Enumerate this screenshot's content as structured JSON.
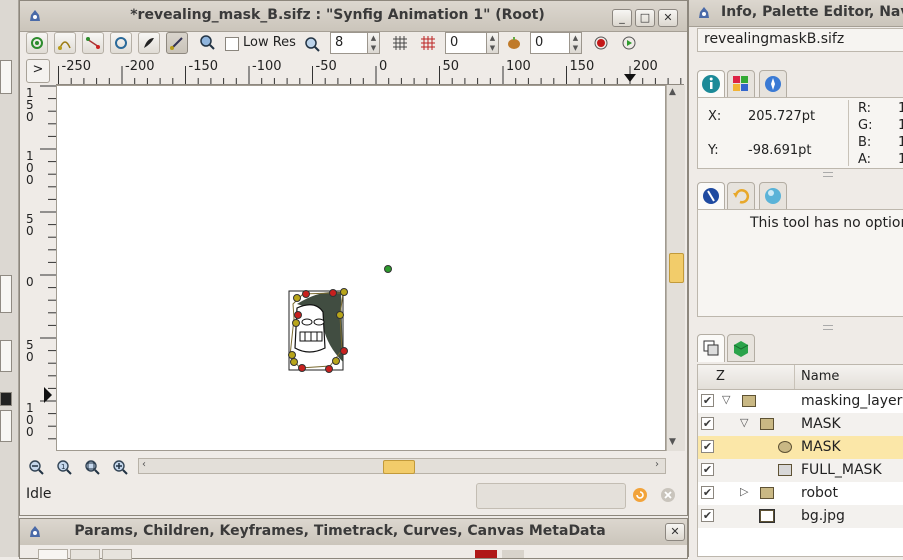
{
  "main_window": {
    "title": "*revealing_mask_B.sifz : \"Synfig Animation 1\" (Root)",
    "minimize": "_",
    "maximize": "□",
    "close": "✕"
  },
  "toolbar": {
    "low_res_label": "Low Res",
    "low_res_checked": false,
    "resolution_value": "8",
    "grid_value": "0",
    "onion_value": "0"
  },
  "ruler": {
    "top_ticks": [
      "-250",
      "-200",
      "-150",
      "-100",
      "-50",
      "0",
      "50",
      "100",
      "150",
      "200"
    ],
    "left_ticks": [
      "150",
      "100",
      "50",
      "0",
      "-50",
      "-100"
    ],
    "nav_arrow": ">"
  },
  "zoom_buttons": [
    "zoom-out-icon",
    "zoom-reset-icon",
    "zoom-fit-icon",
    "zoom-in-icon"
  ],
  "status": {
    "text": "Idle"
  },
  "right_panel": {
    "title": "Info, Palette Editor, Nav",
    "filename": "revealingmaskB.sifz",
    "info": {
      "x_label": "X:",
      "x_value": "205.727pt",
      "y_label": "Y:",
      "y_value": "-98.691pt",
      "r_label": "R:",
      "g_label": "G:",
      "b_label": "B:",
      "a_label": "A:",
      "r_value": "1",
      "g_value": "1",
      "b_value": "1",
      "a_value": "1"
    },
    "tool_options_text": "This tool has no options",
    "layers_header": {
      "z": "Z",
      "name": "Name"
    },
    "layers": [
      {
        "name": "masking_layer",
        "checked": true,
        "expanded": true,
        "indent": 0
      },
      {
        "name": "MASK",
        "checked": true,
        "expanded": true,
        "indent": 1
      },
      {
        "name": "MASK",
        "checked": true,
        "indent": 2,
        "selected": true
      },
      {
        "name": "FULL_MASK",
        "checked": true,
        "indent": 2
      },
      {
        "name": "robot",
        "checked": true,
        "expanded": false,
        "indent": 1
      },
      {
        "name": "bg.jpg",
        "checked": true,
        "indent": 1
      }
    ]
  },
  "params_window": {
    "title": "Params, Children, Keyframes, Timetrack, Curves, Canvas MetaData",
    "close": "✕"
  },
  "colors": {
    "selection": "#fbe7a8",
    "canvas_bg": "#ffffff",
    "duck_red": "#c8201e",
    "duck_yellow": "#b8a51a",
    "duck_green": "#2d9b2d"
  }
}
